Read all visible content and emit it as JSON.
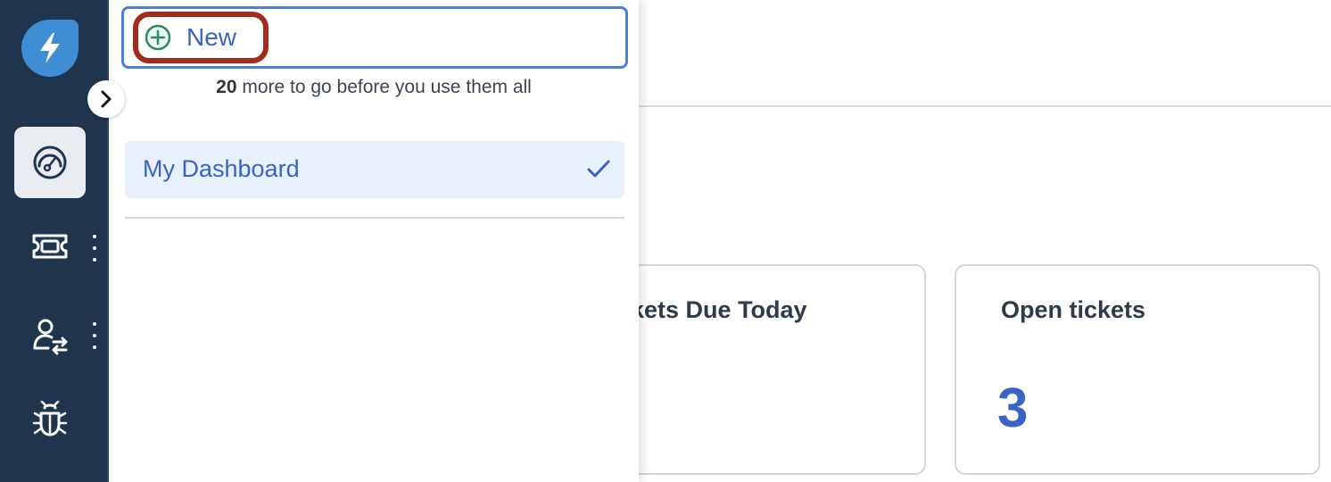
{
  "sidebar": {
    "items": [
      {
        "icon": "dashboard-gauge-icon",
        "active": true
      },
      {
        "icon": "ticket-icon",
        "has_menu": true
      },
      {
        "icon": "user-transfer-icon",
        "has_menu": true
      },
      {
        "icon": "bug-icon"
      }
    ]
  },
  "dropdown": {
    "new_label": "New",
    "remaining_count": "20",
    "remaining_text": " more to go before you use them all",
    "dashboards": [
      {
        "label": "My Dashboard",
        "selected": true
      }
    ]
  },
  "main": {
    "cards": [
      {
        "title": "Tickets Due Today",
        "visible_title": "ckets Due Today",
        "value": ""
      },
      {
        "title": "Open tickets",
        "value": "3"
      }
    ]
  },
  "colors": {
    "sidebar_bg": "#1f344d",
    "logo_bg": "#3f8ed4",
    "accent_blue": "#3a64c4",
    "highlight_red": "#a52a1c",
    "selected_bg": "#e8f0fc",
    "plus_icon_green": "#2e8a6a"
  }
}
